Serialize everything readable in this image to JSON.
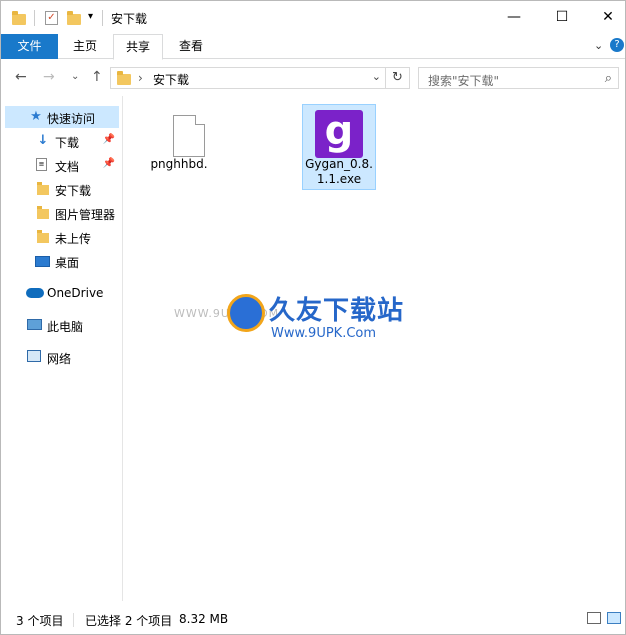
{
  "window": {
    "title": "安下载",
    "minimize_glyph": "—",
    "maximize_glyph": "☐",
    "close_glyph": "✕"
  },
  "ribbon": {
    "file_tab": "文件",
    "tabs": [
      "主页",
      "共享",
      "查看"
    ],
    "collapse_glyph": "⌄",
    "help_glyph": "?"
  },
  "nav": {
    "back_glyph": "←",
    "forward_glyph": "→",
    "recent_glyph": "⌄",
    "up_glyph": "↑",
    "address_separator": "›",
    "address_path": "安下载",
    "address_dropdown_glyph": "⌄",
    "refresh_glyph": "↻",
    "search_placeholder": "搜索\"安下载\"",
    "search_glyph": "⌕"
  },
  "sidebar": {
    "quick_access": "快速访问",
    "items": [
      {
        "label": "下载",
        "icon": "download-icon",
        "pinned": true
      },
      {
        "label": "文档",
        "icon": "document-icon",
        "pinned": true
      },
      {
        "label": "安下载",
        "icon": "folder-icon",
        "pinned": false
      },
      {
        "label": "图片管理器",
        "icon": "folder-icon",
        "pinned": false
      },
      {
        "label": "未上传",
        "icon": "folder-icon",
        "pinned": false
      },
      {
        "label": "桌面",
        "icon": "desktop-icon",
        "pinned": false
      }
    ],
    "onedrive": "OneDrive",
    "this_pc": "此电脑",
    "network": "网络"
  },
  "files": [
    {
      "name": "pnghhbd.",
      "icon": "blank-file-icon",
      "selected": false
    },
    {
      "name_line1": "Gygan_0.8.",
      "name_line2": "1.1.exe",
      "icon": "gygan-app-icon",
      "icon_letter": "g",
      "selected": true
    }
  ],
  "watermark": {
    "left_text": "WWW.9UPK.COM",
    "big_text": "久友下载站",
    "small_text": "Www.9UPK.Com"
  },
  "status": {
    "item_count": "3 个项目",
    "selection": "已选择 2 个项目",
    "size": "8.32 MB"
  },
  "colors": {
    "accent": "#1979ca",
    "selection": "#cce8ff",
    "folder": "#f3c75f",
    "app_icon": "#7b22c9"
  }
}
